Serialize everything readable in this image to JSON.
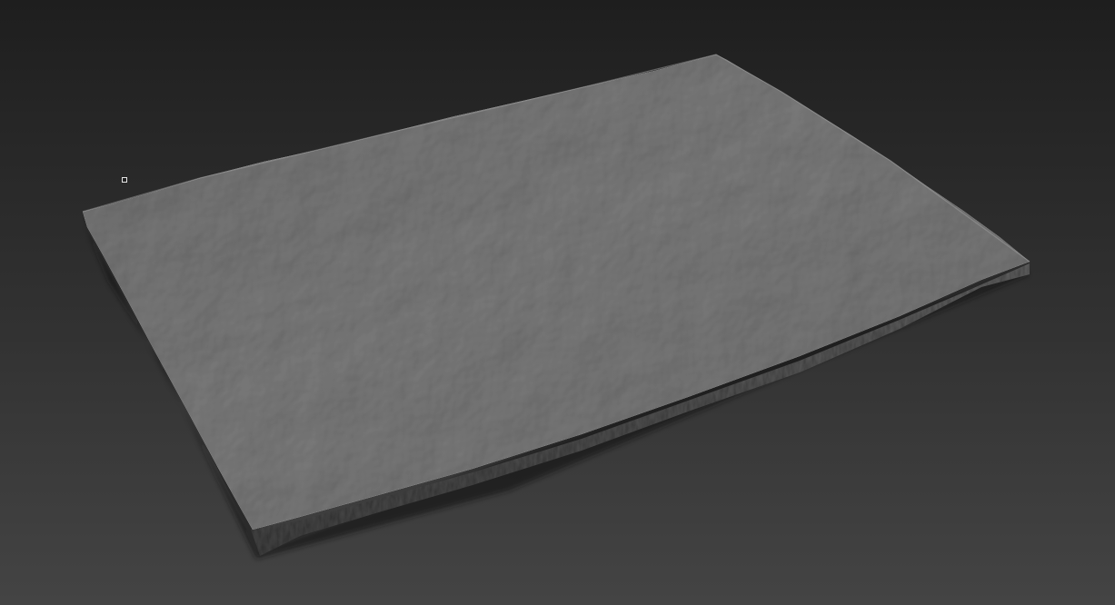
{
  "viewport": {
    "background_top": "#1e1e1e",
    "background_bottom": "#444444"
  },
  "object": {
    "type": "stone-slab",
    "material": "grey-clay",
    "top_color": "#7d7d7d",
    "edge_color": "#555555",
    "shadow_color": "#141414"
  },
  "marker": {
    "icon": "pivot-marker-icon"
  }
}
